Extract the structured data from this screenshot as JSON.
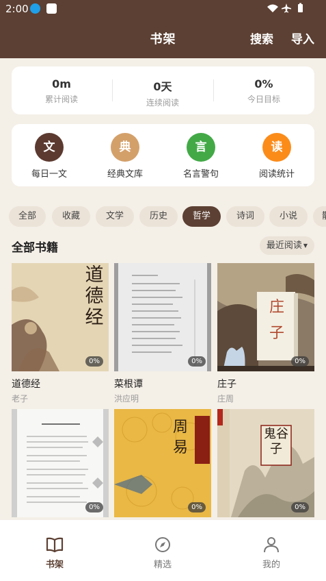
{
  "status_bar": {
    "time": "2:00"
  },
  "header": {
    "title": "书架",
    "search_label": "搜索",
    "import_label": "导入"
  },
  "stats": [
    {
      "value": "0m",
      "label": "累计阅读"
    },
    {
      "value": "0天",
      "label": "连续阅读"
    },
    {
      "value": "0%",
      "label": "今日目标"
    }
  ],
  "tools": [
    {
      "glyph": "文",
      "label": "每日一文",
      "color": "#5c3a30"
    },
    {
      "glyph": "典",
      "label": "经典文库",
      "color": "#d4a06a"
    },
    {
      "glyph": "言",
      "label": "名言警句",
      "color": "#43a947"
    },
    {
      "glyph": "读",
      "label": "阅读统计",
      "color": "#fb8c1a"
    }
  ],
  "categories": [
    "全部",
    "收藏",
    "文学",
    "历史",
    "哲学",
    "诗词",
    "小说",
    "散"
  ],
  "active_category": "哲学",
  "section": {
    "title": "全部书籍",
    "sort_label": "最近阅读"
  },
  "books": [
    {
      "title": "道德经",
      "author": "老子",
      "progress": "0%",
      "cover_text": "道德经"
    },
    {
      "title": "菜根谭",
      "author": "洪应明",
      "progress": "0%",
      "cover_text": ""
    },
    {
      "title": "庄子",
      "author": "庄周",
      "progress": "0%",
      "cover_text": "庄子"
    },
    {
      "title": "",
      "author": "",
      "progress": "0%",
      "cover_text": ""
    },
    {
      "title": "",
      "author": "",
      "progress": "0%",
      "cover_text": "周易"
    },
    {
      "title": "",
      "author": "",
      "progress": "0%",
      "cover_text": "鬼谷子"
    }
  ],
  "bottom_nav": [
    {
      "label": "书架",
      "icon": "book-open-icon",
      "active": true
    },
    {
      "label": "精选",
      "icon": "compass-icon",
      "active": false
    },
    {
      "label": "我的",
      "icon": "user-icon",
      "active": false
    }
  ]
}
